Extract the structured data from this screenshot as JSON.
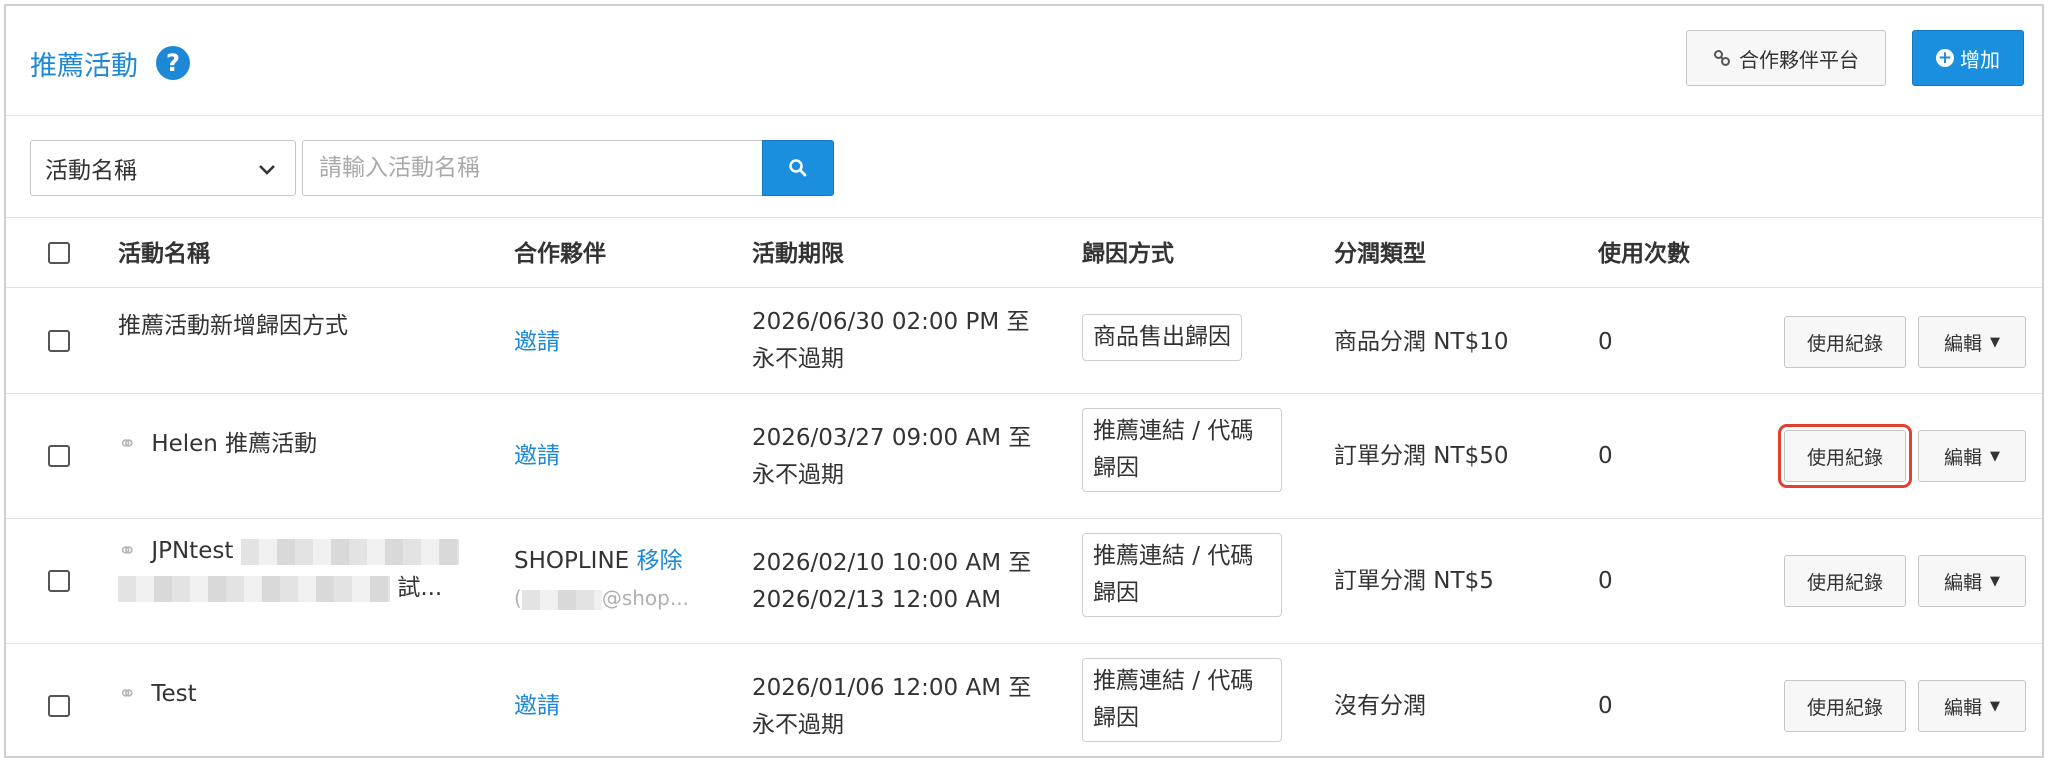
{
  "header": {
    "title": "推薦活動",
    "help_glyph": "?",
    "partner_button": "合作夥伴平台",
    "add_button": "增加"
  },
  "filter": {
    "select_value": "活動名稱",
    "search_placeholder": "請輸入活動名稱"
  },
  "table": {
    "columns": [
      "活動名稱",
      "合作夥伴",
      "活動期限",
      "歸因方式",
      "分潤類型",
      "使用次數"
    ],
    "rows": [
      {
        "name": "推薦活動新增歸因方式",
        "partner": "邀請",
        "period_line1": "2026/06/30 02:00 PM 至",
        "period_line2": "永不過期",
        "attribution": "商品售出歸因",
        "commission": "商品分潤 NT$10",
        "count": "0",
        "log_button": "使用紀錄",
        "edit_button": "編輯"
      },
      {
        "name": "Helen 推薦活動",
        "partner": "邀請",
        "period_line1": "2026/03/27 09:00 AM 至",
        "period_line2": "永不過期",
        "attribution_line1": "推薦連結 / 代碼",
        "attribution_line2": "歸因",
        "commission": "訂單分潤 NT$50",
        "count": "0",
        "log_button": "使用紀錄",
        "edit_button": "編輯"
      },
      {
        "name_prefix": "JPNtest",
        "name_suffix": "試...",
        "partner_name": "SHOPLINE",
        "partner_action": "移除",
        "partner_email_prefix": "(",
        "partner_email_suffix": "@shop...",
        "period_line1": "2026/02/10 10:00 AM 至",
        "period_line2": "2026/02/13 12:00 AM",
        "attribution_line1": "推薦連結 / 代碼",
        "attribution_line2": "歸因",
        "commission": "訂單分潤 NT$5",
        "count": "0",
        "log_button": "使用紀錄",
        "edit_button": "編輯"
      },
      {
        "name": "Test",
        "partner": "邀請",
        "period_line1": "2026/01/06 12:00 AM 至",
        "period_line2": "永不過期",
        "attribution_line1": "推薦連結 / 代碼",
        "attribution_line2": "歸因",
        "commission": "沒有分潤",
        "count": "0",
        "log_button": "使用紀錄",
        "edit_button": "編輯"
      }
    ]
  },
  "colors": {
    "accent": "#1e88d8",
    "primary_button": "#1a8fdd",
    "highlight": "#e2412f"
  }
}
